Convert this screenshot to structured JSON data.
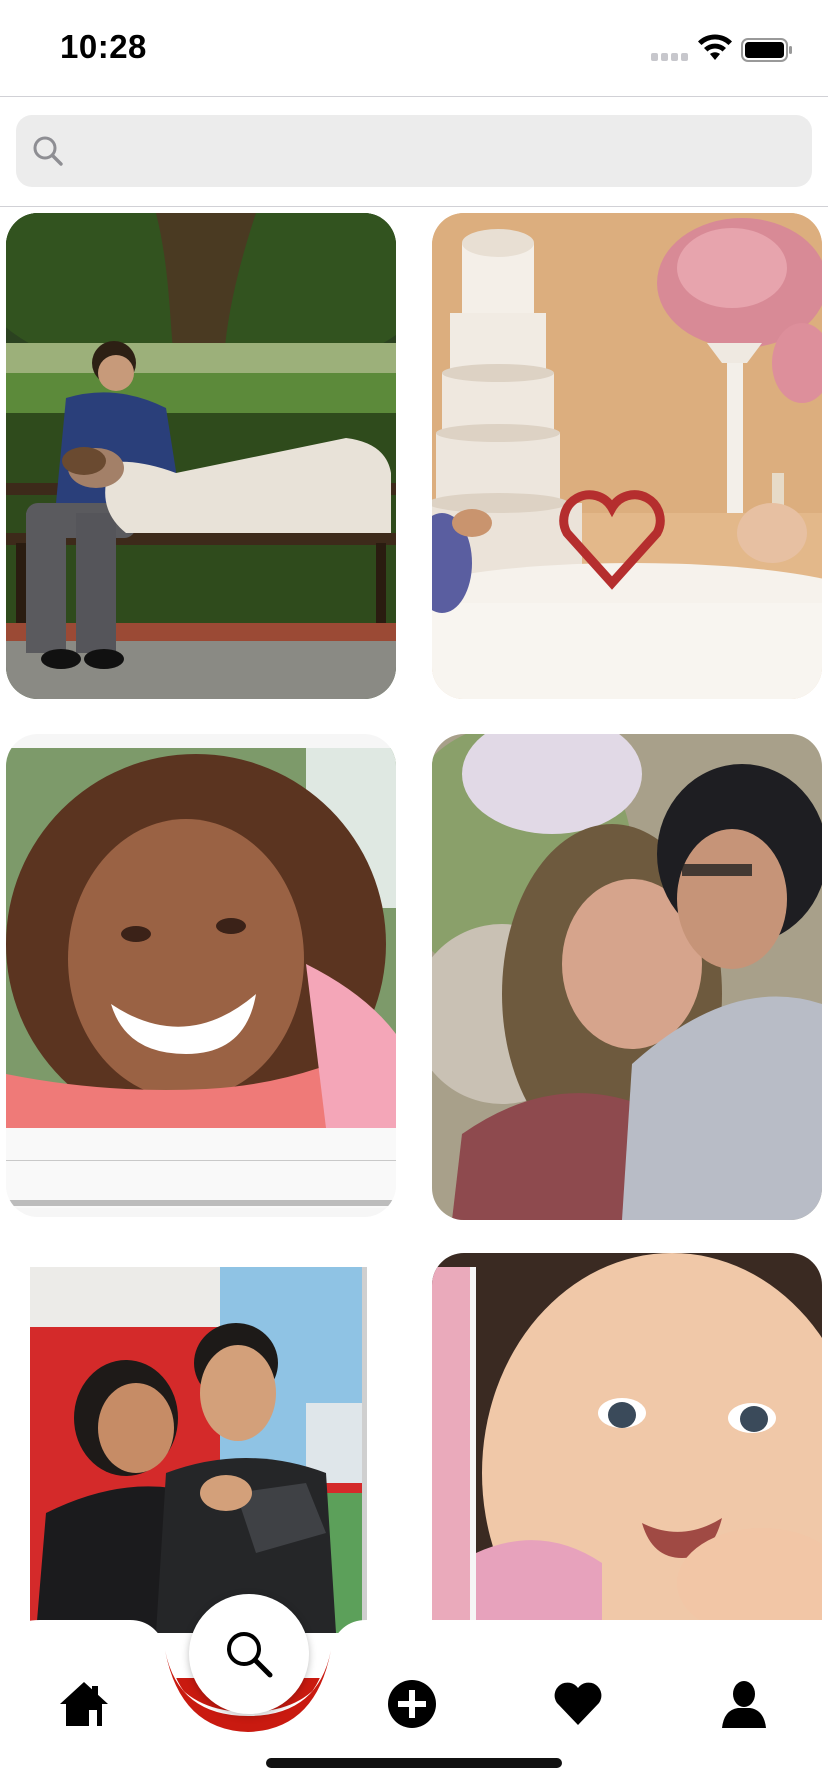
{
  "status_bar": {
    "time": "10:28",
    "icons": [
      "cellular-signal-icon",
      "wifi-icon",
      "battery-icon"
    ]
  },
  "search": {
    "placeholder": "",
    "value": "",
    "icon": "search-icon"
  },
  "grid": {
    "photos": [
      "photo-couple-on-bench",
      "photo-wedding-cake-table",
      "photo-smiling-girl",
      "photo-couple-embracing",
      "photo-surfer-couple",
      "photo-smiling-baby"
    ]
  },
  "tab_bar": {
    "tabs": [
      "home-icon",
      "search-icon",
      "add-icon",
      "heart-icon",
      "profile-icon"
    ],
    "active_tab": "search-icon",
    "accent_color": "#c91a10"
  }
}
